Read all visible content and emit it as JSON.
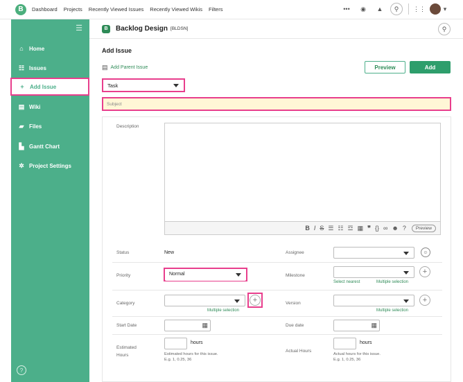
{
  "topbar": {
    "nav": [
      "Dashboard",
      "Projects",
      "Recently Viewed Issues",
      "Recently Viewed Wikis",
      "Filters"
    ],
    "icons": [
      "more-icon",
      "watch-icon",
      "notification-icon",
      "search-icon",
      "apps-icon",
      "avatar"
    ]
  },
  "sidebar": {
    "items": [
      {
        "label": "Home",
        "icon": "home-icon"
      },
      {
        "label": "Issues",
        "icon": "issues-icon"
      },
      {
        "label": "Add Issue",
        "icon": "plus-icon"
      },
      {
        "label": "Wiki",
        "icon": "wiki-icon"
      },
      {
        "label": "Files",
        "icon": "files-icon"
      },
      {
        "label": "Gantt Chart",
        "icon": "gantt-icon"
      },
      {
        "label": "Project Settings",
        "icon": "gear-icon"
      }
    ],
    "active": "Add Issue"
  },
  "project": {
    "name": "Backlog Design",
    "key": "[BLDSN]"
  },
  "main": {
    "title": "Add Issue",
    "add_parent": "Add Parent Issue",
    "preview_btn": "Preview",
    "add_btn": "Add",
    "issue_type": "Task",
    "subject_placeholder": "Subject",
    "description_label": "Description",
    "toolbar_preview": "Preview"
  },
  "fields": {
    "status_label": "Status",
    "status_value": "New",
    "assignee_label": "Assignee",
    "priority_label": "Priority",
    "priority_value": "Normal",
    "milestone_label": "Milestone",
    "select_nearest": "Select nearest",
    "multiple_selection": "Multiple selection",
    "category_label": "Category",
    "version_label": "Version",
    "start_date_label": "Start Date",
    "due_date_label": "Due date",
    "estimated_label_1": "Estimated",
    "estimated_label_2": "Hours",
    "hours": "hours",
    "estimated_hint_1": "Estimated hours for this issue.",
    "hint_eg": "E.g. 1, 0.25, 36",
    "actual_label": "Actual Hours",
    "actual_hint_1": "Actual hours for this issue."
  },
  "colors": {
    "sidebar": "#4caf8a",
    "accent": "#2e9e6c",
    "highlight": "#e83e8c"
  }
}
